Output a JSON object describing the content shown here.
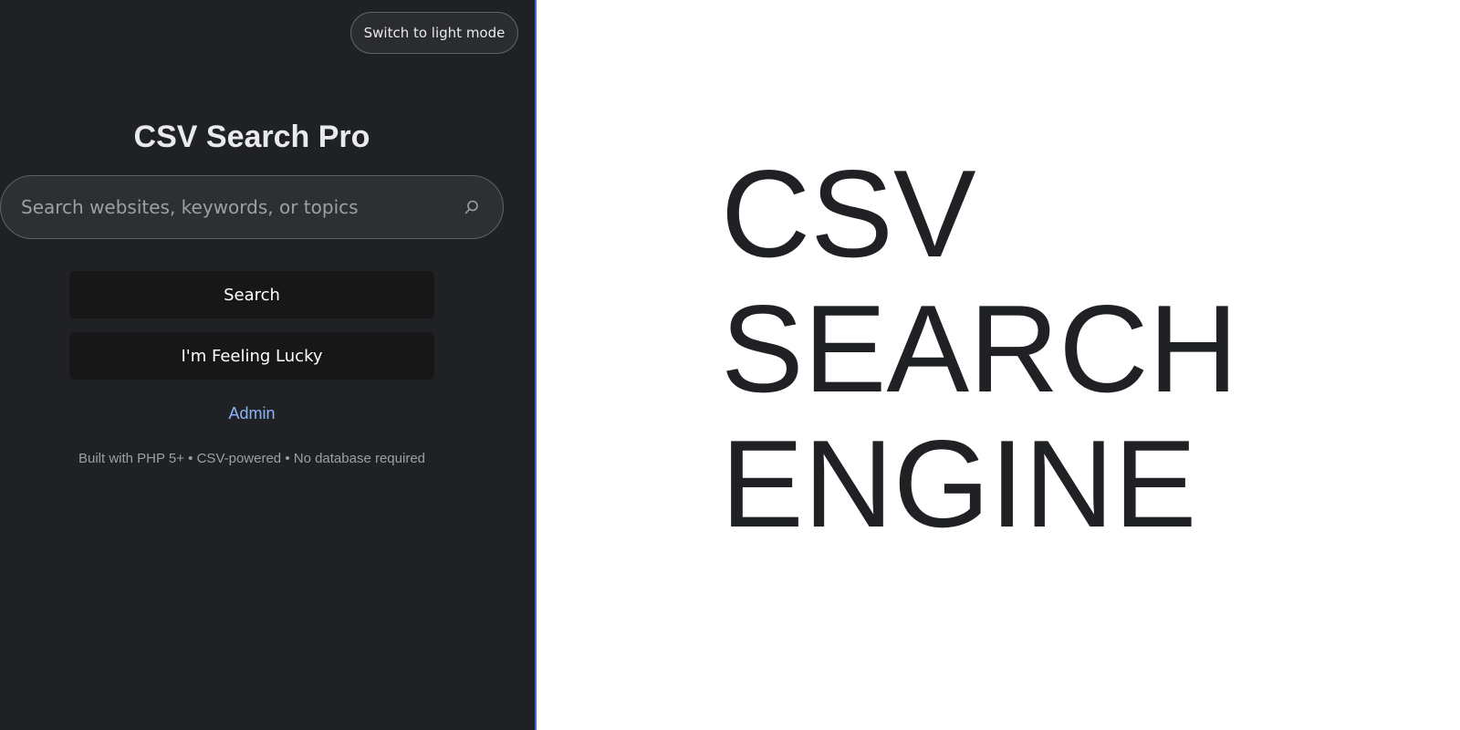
{
  "header": {
    "theme_toggle_label": "Switch to light mode"
  },
  "main": {
    "title": "CSV Search Pro",
    "search": {
      "placeholder": "Search websites, keywords, or topics",
      "value": "",
      "icon": "search-icon"
    },
    "buttons": {
      "search_label": "Search",
      "lucky_label": "I'm Feeling Lucky"
    },
    "admin_link": "Admin",
    "footer_note": "Built with PHP 5+ • CSV-powered • No database required"
  },
  "hero": {
    "lines": [
      "CSV",
      "SEARCH",
      "ENGINE"
    ]
  },
  "colors": {
    "panel_background": "#202124",
    "accent_link": "#8ab4f8",
    "button_background": "#171717",
    "hero_text": "#202124",
    "page_background": "#ffffff"
  }
}
